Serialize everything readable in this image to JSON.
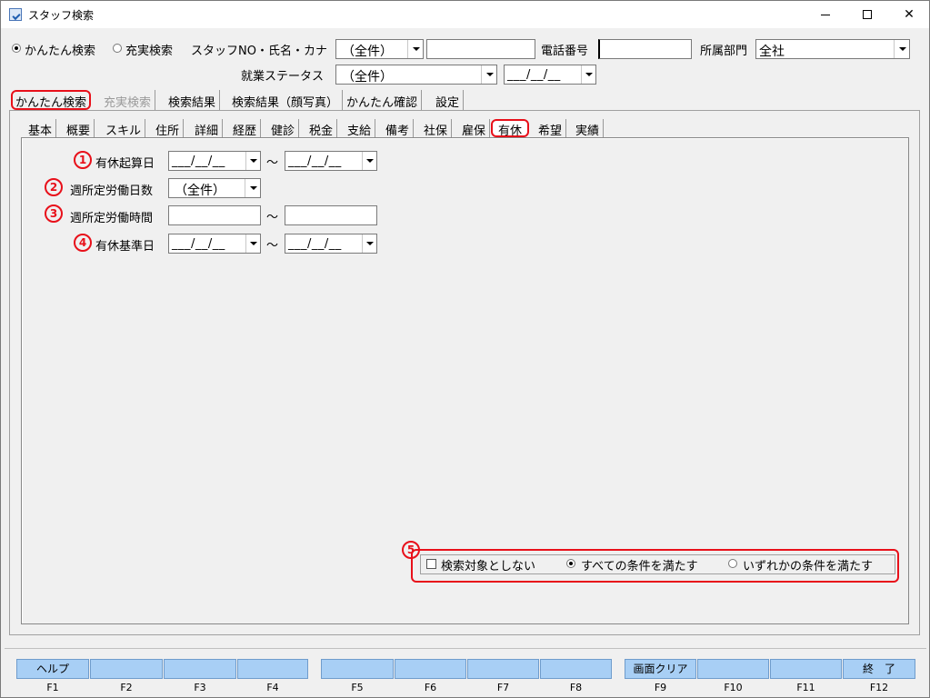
{
  "window": {
    "title": "スタッフ検索"
  },
  "search_mode": {
    "easy_label": "かんたん検索",
    "full_label": "充実検索",
    "selected": "easy"
  },
  "header": {
    "staff_label": "スタッフNO・氏名・カナ",
    "staff_combo_value": "（全件）",
    "staff_text_value": "",
    "phone_label": "電話番号",
    "phone_value": "",
    "dept_label": "所属部門",
    "dept_value": "全社",
    "status_label": "就業ステータス",
    "status_value": "（全件）",
    "status_date_value": "___/__/__"
  },
  "tabs": [
    {
      "label": "かんたん検索",
      "state": "active"
    },
    {
      "label": "充実検索",
      "state": "disabled"
    },
    {
      "label": "検索結果",
      "state": "normal"
    },
    {
      "label": "検索結果（顔写真）",
      "state": "normal"
    },
    {
      "label": "かんたん確認",
      "state": "normal"
    },
    {
      "label": "設定",
      "state": "normal"
    }
  ],
  "subtabs": [
    "基本",
    "概要",
    "スキル",
    "住所",
    "詳細",
    "経歴",
    "健診",
    "税金",
    "支給",
    "備考",
    "社保",
    "雇保",
    "有休",
    "希望",
    "実績"
  ],
  "active_subtab": "有休",
  "fields": [
    {
      "marker": "1",
      "label": "有休起算日",
      "from": "___/__/__",
      "to": "___/__/__"
    },
    {
      "marker": "2",
      "label": "週所定労働日数",
      "value": "（全件）"
    },
    {
      "marker": "3",
      "label": "週所定労働時間",
      "from": "",
      "to": ""
    },
    {
      "marker": "4",
      "label": "有休基準日",
      "from": "___/__/__",
      "to": "___/__/__"
    }
  ],
  "range_sep": "～",
  "options": {
    "marker": "5",
    "exclude_label": "検索対象としない",
    "exclude_checked": false,
    "all_label": "すべての条件を満たす",
    "any_label": "いずれかの条件を満たす",
    "selected": "all"
  },
  "fkeys": [
    {
      "key": "F1",
      "label": "ヘルプ"
    },
    {
      "key": "F2",
      "label": ""
    },
    {
      "key": "F3",
      "label": ""
    },
    {
      "key": "F4",
      "label": ""
    },
    {
      "key": "F5",
      "label": ""
    },
    {
      "key": "F6",
      "label": ""
    },
    {
      "key": "F7",
      "label": ""
    },
    {
      "key": "F8",
      "label": ""
    },
    {
      "key": "F9",
      "label": "画面クリア"
    },
    {
      "key": "F10",
      "label": ""
    },
    {
      "key": "F11",
      "label": ""
    },
    {
      "key": "F12",
      "label": "終　了"
    }
  ],
  "colors": {
    "highlight": "#e8101a",
    "fkey_bg": "#a8cff5",
    "window_bg": "#f0f0f0"
  },
  "icons": {
    "app": "app-window-icon",
    "minimize": "minimize-icon",
    "maximize": "maximize-icon",
    "close": "close-icon"
  }
}
